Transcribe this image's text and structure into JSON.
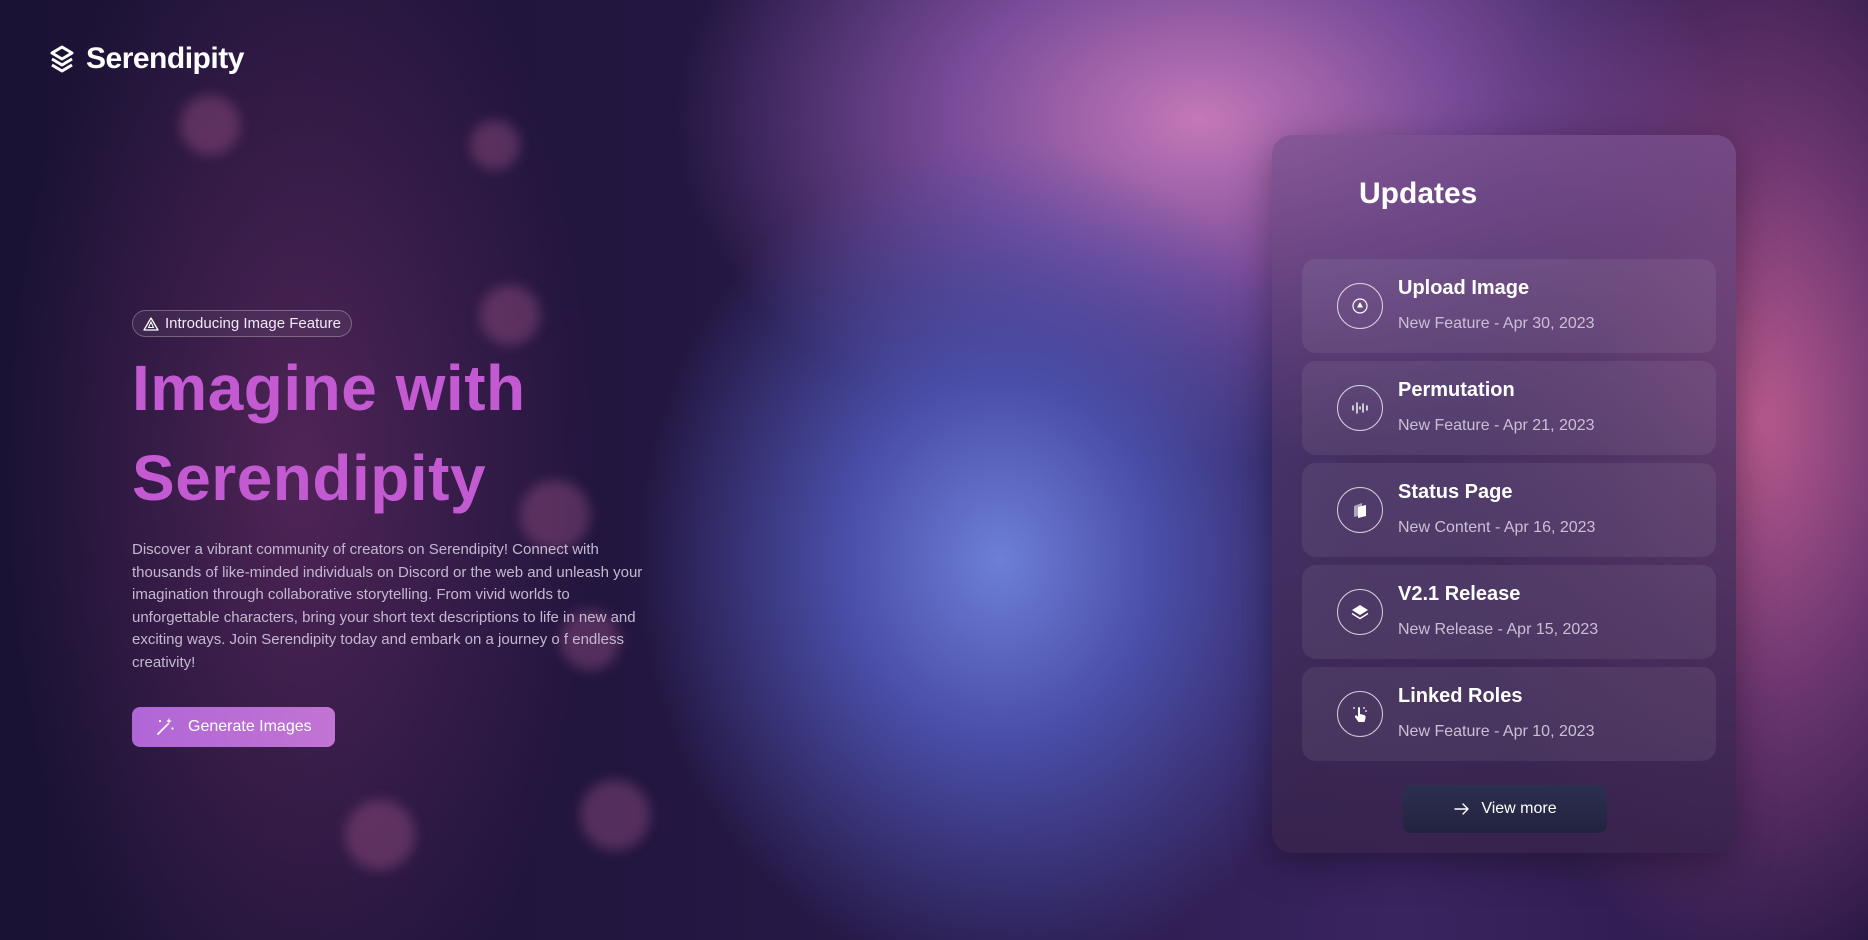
{
  "brand": {
    "name": "Serendipity"
  },
  "hero": {
    "pill_label": "Introducing Image Feature",
    "headline_line1": "Imagine with",
    "headline_line2": "Serendipity",
    "description": "Discover a vibrant community of creators on Serendipity! Connect with thousands of like-minded individuals on Discord or the web and unleash your imagination through collaborative storytelling. From vivid worlds to unforgettable characters, bring your short text descriptions to life in new and exciting ways. Join Serendipity today and embark on a journey o f endless creativity!",
    "cta_label": "Generate Images",
    "headline_color": "#c45ad2"
  },
  "updates": {
    "title": "Updates",
    "items": [
      {
        "title": "Upload Image",
        "subtitle": "New Feature - Apr 30, 2023",
        "icon": "upload-icon"
      },
      {
        "title": "Permutation",
        "subtitle": "New Feature - Apr 21, 2023",
        "icon": "waveform-icon"
      },
      {
        "title": "Status Page",
        "subtitle": "New Content - Apr 16, 2023",
        "icon": "pages-icon"
      },
      {
        "title": "V2.1 Release",
        "subtitle": "New Release - Apr 15, 2023",
        "icon": "layers-icon"
      },
      {
        "title": "Linked Roles",
        "subtitle": "New Feature - Apr 10, 2023",
        "icon": "tap-icon"
      }
    ],
    "view_more_label": "View more"
  },
  "accent_color": "#b066d6"
}
